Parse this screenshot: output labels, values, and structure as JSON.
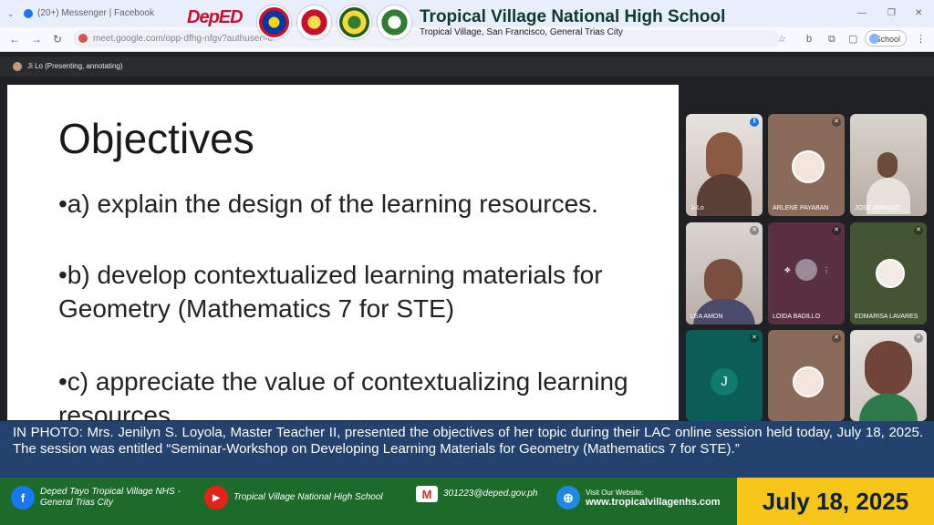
{
  "browser": {
    "tab_title": "(20+) Messenger | Facebook",
    "url": "meet.google.com/opp-dfhg-nfgv?authuser=0",
    "profile_label": "School"
  },
  "header": {
    "logo_text": "DepED",
    "school_name": "Tropical Village National High School",
    "school_address": "Tropical Village, San Francisco, General Trias City"
  },
  "meet": {
    "presenter_label": "Ji Lo (Presenting, annotating)",
    "participants": [
      {
        "name": "Ji Lo",
        "state": "video"
      },
      {
        "name": "ARLENE PAYABAN",
        "state": "avatar"
      },
      {
        "name": "JOSE AMPARO",
        "state": "video"
      },
      {
        "name": "LEA AMON",
        "state": "video"
      },
      {
        "name": "LOIDA BADILLO",
        "state": "avatar"
      },
      {
        "name": "EDMARISA LAVARES",
        "state": "avatar"
      },
      {
        "name": "",
        "initial": "J",
        "state": "initial"
      },
      {
        "name": "",
        "state": "avatar"
      },
      {
        "name": "",
        "state": "video"
      }
    ]
  },
  "slide": {
    "title": "Objectives",
    "bullets": [
      "•a) explain the design of the learning resources.",
      "•b) develop contextualized learning materials for Geometry (Mathematics 7 for STE)",
      "•c) appreciate the value of contextualizing learning resources."
    ]
  },
  "caption": "IN PHOTO: Mrs. Jenilyn S. Loyola, Master Teacher II, presented the objectives of her topic during their LAC online session held today, July 18, 2025. The session was entitled “Seminar-Workshop on Developing Learning Materials for Geometry (Mathematics 7 for STE).”",
  "footer": {
    "facebook": "Deped Tayo Tropical Village NHS - General Trias City",
    "youtube": "Tropical Village National High School",
    "email": "301223@deped.gov.ph",
    "website_label": "Visit Our Website:",
    "website": "www.tropicalvillagenhs.com",
    "date": "July 18, 2025"
  },
  "colors": {
    "caption_bg": "#23426e",
    "footer_bg": "#1d6b2a",
    "date_bg": "#f5c518"
  }
}
